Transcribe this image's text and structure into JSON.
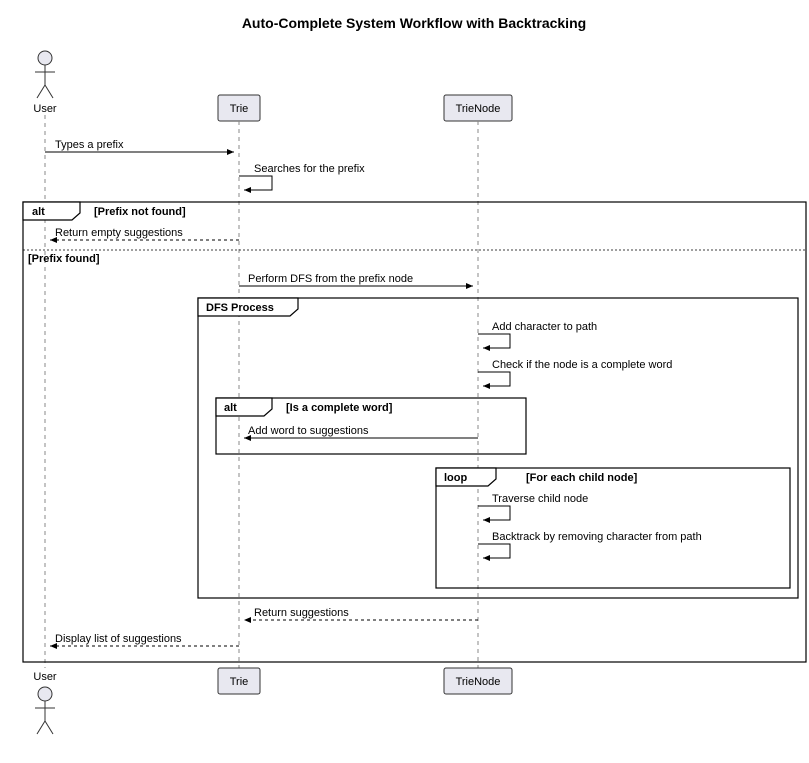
{
  "title": "Auto-Complete System Workflow with Backtracking",
  "actors": {
    "user": "User",
    "trie": "Trie",
    "node": "TrieNode"
  },
  "msgs": {
    "m1": "Types a prefix",
    "m2": "Searches for the prefix",
    "m3": "Return empty suggestions",
    "m4": "Perform DFS from the prefix node",
    "m5": "Add character to path",
    "m6": "Check if the node is a complete word",
    "m7": "Add word to suggestions",
    "m8": "Traverse child node",
    "m9": "Backtrack by removing character from path",
    "m10": "Return suggestions",
    "m11": "Display list of suggestions"
  },
  "frames": {
    "alt": "alt",
    "cond1": "[Prefix not found]",
    "cond2": "[Prefix found]",
    "group": "DFS Process",
    "cond3": "[Is a complete word]",
    "loop": "loop",
    "cond4": "[For each child node]"
  }
}
